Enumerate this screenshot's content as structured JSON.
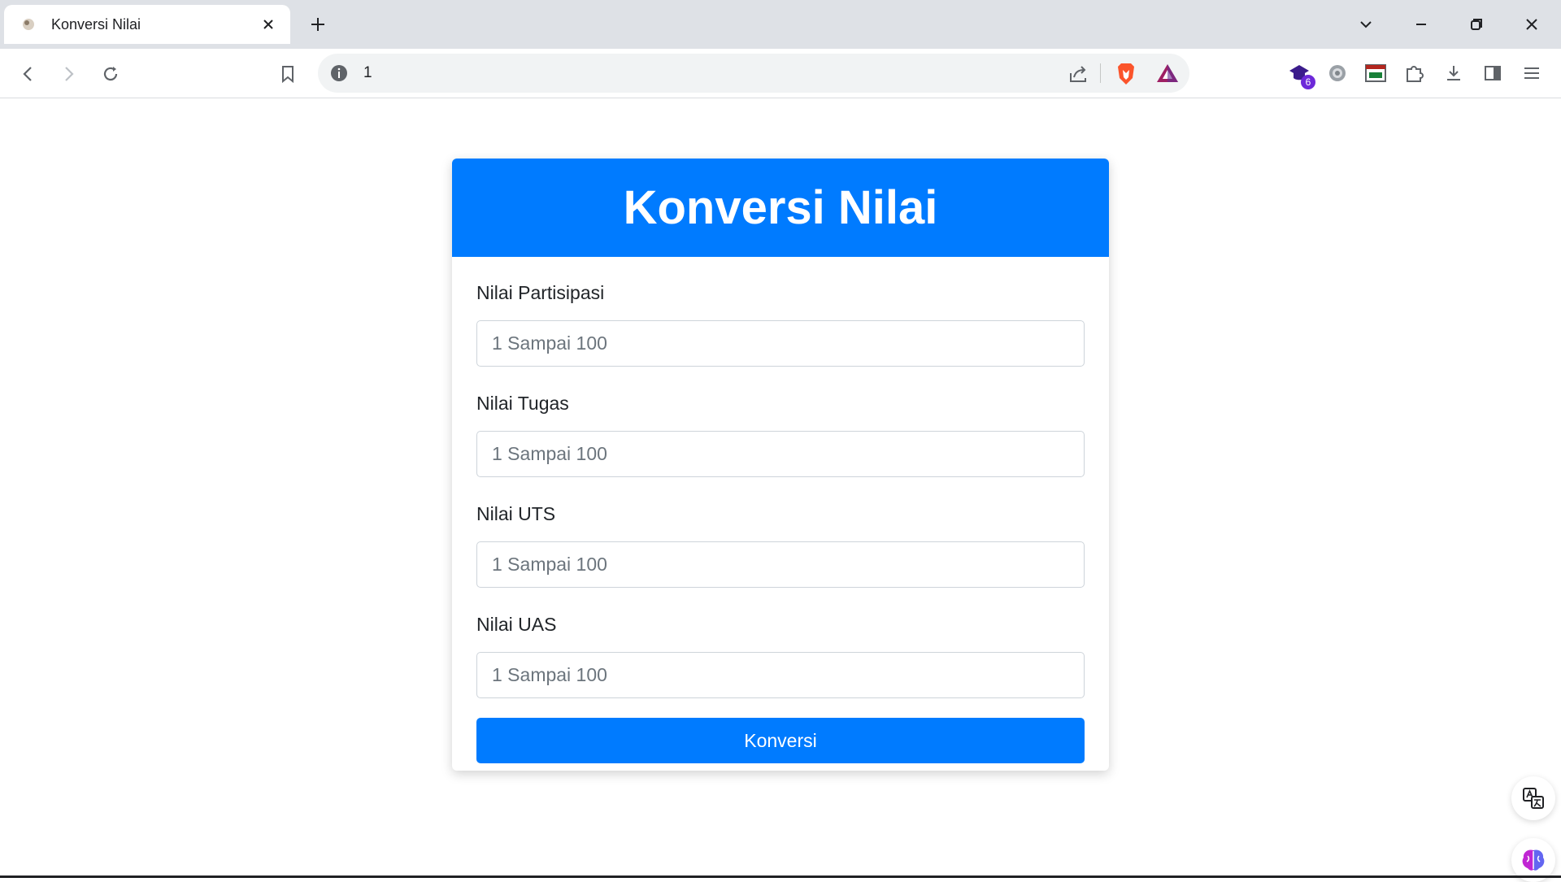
{
  "browser": {
    "tab_title": "Konversi Nilai",
    "address": "1",
    "extension_badge": "6"
  },
  "form": {
    "title": "Konversi Nilai",
    "fields": [
      {
        "label": "Nilai Partisipasi",
        "placeholder": "1 Sampai 100"
      },
      {
        "label": "Nilai Tugas",
        "placeholder": "1 Sampai 100"
      },
      {
        "label": "Nilai UTS",
        "placeholder": "1 Sampai 100"
      },
      {
        "label": "Nilai UAS",
        "placeholder": "1 Sampai 100"
      }
    ],
    "submit_label": "Konversi"
  },
  "colors": {
    "primary": "#007bff",
    "tabbar": "#dee1e6"
  },
  "icons": [
    "favicon-icon",
    "close-icon",
    "plus-icon",
    "chevron-down-icon",
    "minimize-icon",
    "restore-icon",
    "back-icon",
    "forward-icon",
    "reload-icon",
    "bookmark-icon",
    "info-icon",
    "share-icon",
    "brave-shield-icon",
    "brave-rewards-icon",
    "extension-icon",
    "gear-icon",
    "calendar-extension-icon",
    "puzzle-icon",
    "download-icon",
    "sidebar-icon",
    "menu-icon",
    "translate-icon",
    "brain-icon"
  ]
}
